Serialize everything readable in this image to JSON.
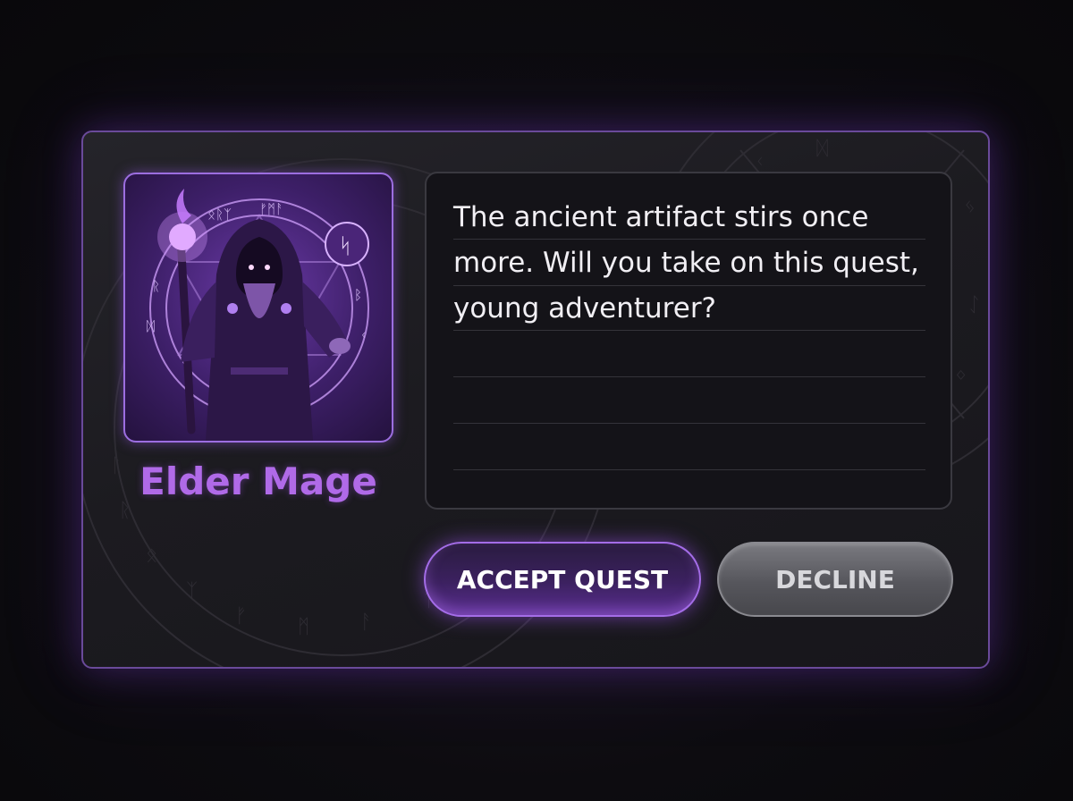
{
  "npc": {
    "name": "Elder Mage",
    "portrait_icon": "hooded-mage-portrait"
  },
  "dialogue": {
    "text": "The ancient artifact stirs once more. Will you take on this quest, young adventurer?"
  },
  "actions": {
    "accept_label": "ACCEPT QUEST",
    "decline_label": "DECLINE"
  },
  "colors": {
    "accent": "#b06ae8",
    "panel_border": "#6a4a9a",
    "accept_fill": "#3c2160",
    "decline_fill": "#5e5e64"
  }
}
